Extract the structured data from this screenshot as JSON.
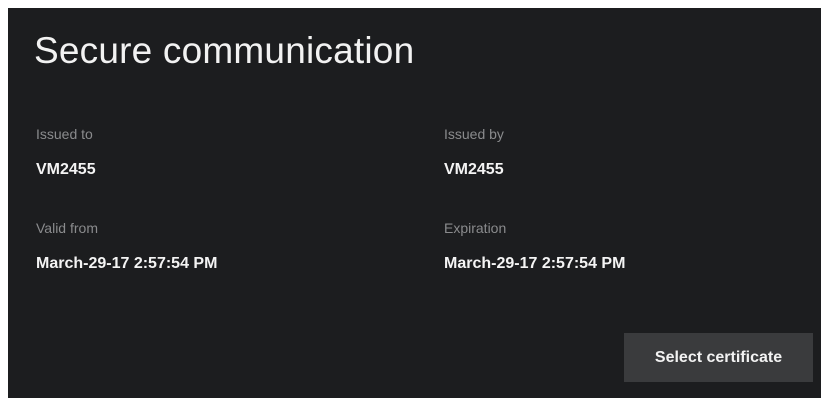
{
  "title": "Secure communication",
  "fields": {
    "issued_to": {
      "label": "Issued to",
      "value": "VM2455"
    },
    "issued_by": {
      "label": "Issued by",
      "value": "VM2455"
    },
    "valid_from": {
      "label": "Valid from",
      "value": "March-29-17 2:57:54 PM"
    },
    "expiration": {
      "label": "Expiration",
      "value": "March-29-17 2:57:54 PM"
    }
  },
  "actions": {
    "select_certificate_label": "Select certificate"
  },
  "colors": {
    "panel_background": "#1c1d1f",
    "label_text": "#8a8b8d",
    "value_text": "#f4f4f4",
    "button_background": "#3a3b3d"
  }
}
